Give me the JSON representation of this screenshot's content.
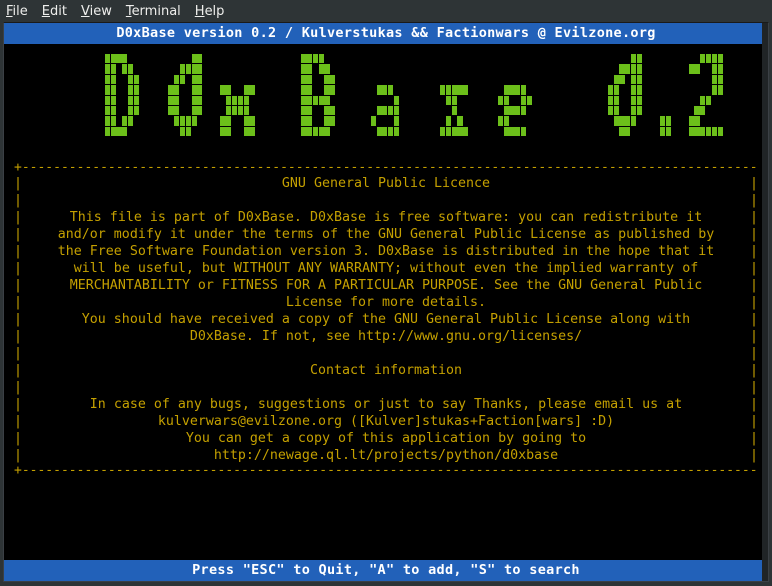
{
  "menu": {
    "file": "File",
    "edit": "Edit",
    "view": "View",
    "terminal": "Terminal",
    "help": "Help"
  },
  "topbar": "D0xBase version 0.2 / Kulverstukas && Factionwars @ Evilzone.org",
  "logo_alt": "D0xBase 0.2",
  "licence": {
    "title": "GNU General Public Licence",
    "lines": [
      "",
      "This file is part of D0xBase. D0xBase is free software: you can redistribute it",
      "and/or modify it under the terms of the GNU General Public License as published by",
      "the Free Software Foundation version 3. D0xBase is distributed in the hope that it",
      "will be useful, but WITHOUT ANY WARRANTY; without even the implied warranty of",
      "MERCHANTABILITY or FITNESS FOR A PARTICULAR PURPOSE. See the GNU General Public",
      "License for more details.",
      "You should have received a copy of the GNU General Public License along with",
      "D0xBase. If not, see http://www.gnu.org/licenses/",
      "",
      "Contact information",
      "",
      "In case of any bugs, suggestions or just to say Thanks, please email us at",
      "kulverwars@evilzone.org ([Kulver]stukas+Faction[wars] :D)",
      "You can get a copy of this application by going to",
      "http://newage.ql.lt/projects/python/d0xbase"
    ]
  },
  "bottombar": {
    "prefix": "Press ",
    "k1": "\"ESC\"",
    "t1": " to Quit, ",
    "k2": "\"A\"",
    "t2": " to add, ",
    "k3": "\"S\"",
    "t3": " to search"
  },
  "dash": "+-------------------------------------------------------------------------------------------------+",
  "logo_bitmap": [
    " XXXX           XX                 XXXX                                                     XX          XXXX  ",
    " XX XX        XXXX                 XX XX                                                  XXXX        XX  XX  ",
    " XX  XX      XX XX                 XX  XX                                                XX XX            XX  ",
    " XX  XX     XX  XX   XX  XX        XX  XX       XXX        XXXXX      XXXX              XX  XX            XX  ",
    " XX  XX     XX  XX    XXXX         XXXXX           X        XX       XX  XX             XX  XX          XX    ",
    " XX  XX     XX  XX    XXXX         XX  XX       XXXX         X        XXXX              XX  XX         XX     ",
    " XX XX       XXXX    XX  XX        XX  XX      X   X        X X      XX                  XXXX    XX   XX      ",
    " XXXX         XX     XX  XX        XXXXX        XXXX       XXXXX      XXXX                XX     XX   XXXXXX  "
  ]
}
